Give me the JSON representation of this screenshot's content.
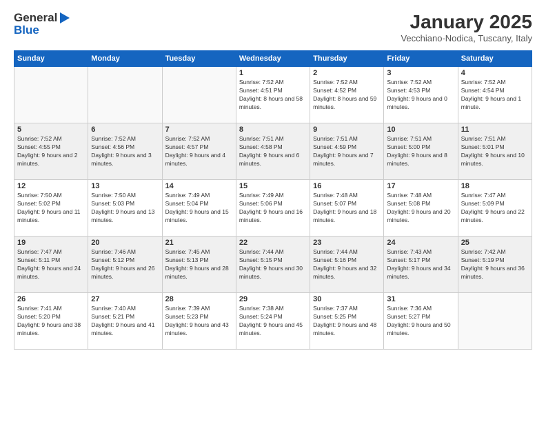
{
  "header": {
    "logo_line1": "General",
    "logo_line2": "Blue",
    "month_title": "January 2025",
    "location": "Vecchiano-Nodica, Tuscany, Italy"
  },
  "weekdays": [
    "Sunday",
    "Monday",
    "Tuesday",
    "Wednesday",
    "Thursday",
    "Friday",
    "Saturday"
  ],
  "weeks": [
    [
      {
        "day": "",
        "info": ""
      },
      {
        "day": "",
        "info": ""
      },
      {
        "day": "",
        "info": ""
      },
      {
        "day": "1",
        "info": "Sunrise: 7:52 AM\nSunset: 4:51 PM\nDaylight: 8 hours and 58 minutes."
      },
      {
        "day": "2",
        "info": "Sunrise: 7:52 AM\nSunset: 4:52 PM\nDaylight: 8 hours and 59 minutes."
      },
      {
        "day": "3",
        "info": "Sunrise: 7:52 AM\nSunset: 4:53 PM\nDaylight: 9 hours and 0 minutes."
      },
      {
        "day": "4",
        "info": "Sunrise: 7:52 AM\nSunset: 4:54 PM\nDaylight: 9 hours and 1 minute."
      }
    ],
    [
      {
        "day": "5",
        "info": "Sunrise: 7:52 AM\nSunset: 4:55 PM\nDaylight: 9 hours and 2 minutes."
      },
      {
        "day": "6",
        "info": "Sunrise: 7:52 AM\nSunset: 4:56 PM\nDaylight: 9 hours and 3 minutes."
      },
      {
        "day": "7",
        "info": "Sunrise: 7:52 AM\nSunset: 4:57 PM\nDaylight: 9 hours and 4 minutes."
      },
      {
        "day": "8",
        "info": "Sunrise: 7:51 AM\nSunset: 4:58 PM\nDaylight: 9 hours and 6 minutes."
      },
      {
        "day": "9",
        "info": "Sunrise: 7:51 AM\nSunset: 4:59 PM\nDaylight: 9 hours and 7 minutes."
      },
      {
        "day": "10",
        "info": "Sunrise: 7:51 AM\nSunset: 5:00 PM\nDaylight: 9 hours and 8 minutes."
      },
      {
        "day": "11",
        "info": "Sunrise: 7:51 AM\nSunset: 5:01 PM\nDaylight: 9 hours and 10 minutes."
      }
    ],
    [
      {
        "day": "12",
        "info": "Sunrise: 7:50 AM\nSunset: 5:02 PM\nDaylight: 9 hours and 11 minutes."
      },
      {
        "day": "13",
        "info": "Sunrise: 7:50 AM\nSunset: 5:03 PM\nDaylight: 9 hours and 13 minutes."
      },
      {
        "day": "14",
        "info": "Sunrise: 7:49 AM\nSunset: 5:04 PM\nDaylight: 9 hours and 15 minutes."
      },
      {
        "day": "15",
        "info": "Sunrise: 7:49 AM\nSunset: 5:06 PM\nDaylight: 9 hours and 16 minutes."
      },
      {
        "day": "16",
        "info": "Sunrise: 7:48 AM\nSunset: 5:07 PM\nDaylight: 9 hours and 18 minutes."
      },
      {
        "day": "17",
        "info": "Sunrise: 7:48 AM\nSunset: 5:08 PM\nDaylight: 9 hours and 20 minutes."
      },
      {
        "day": "18",
        "info": "Sunrise: 7:47 AM\nSunset: 5:09 PM\nDaylight: 9 hours and 22 minutes."
      }
    ],
    [
      {
        "day": "19",
        "info": "Sunrise: 7:47 AM\nSunset: 5:11 PM\nDaylight: 9 hours and 24 minutes."
      },
      {
        "day": "20",
        "info": "Sunrise: 7:46 AM\nSunset: 5:12 PM\nDaylight: 9 hours and 26 minutes."
      },
      {
        "day": "21",
        "info": "Sunrise: 7:45 AM\nSunset: 5:13 PM\nDaylight: 9 hours and 28 minutes."
      },
      {
        "day": "22",
        "info": "Sunrise: 7:44 AM\nSunset: 5:15 PM\nDaylight: 9 hours and 30 minutes."
      },
      {
        "day": "23",
        "info": "Sunrise: 7:44 AM\nSunset: 5:16 PM\nDaylight: 9 hours and 32 minutes."
      },
      {
        "day": "24",
        "info": "Sunrise: 7:43 AM\nSunset: 5:17 PM\nDaylight: 9 hours and 34 minutes."
      },
      {
        "day": "25",
        "info": "Sunrise: 7:42 AM\nSunset: 5:19 PM\nDaylight: 9 hours and 36 minutes."
      }
    ],
    [
      {
        "day": "26",
        "info": "Sunrise: 7:41 AM\nSunset: 5:20 PM\nDaylight: 9 hours and 38 minutes."
      },
      {
        "day": "27",
        "info": "Sunrise: 7:40 AM\nSunset: 5:21 PM\nDaylight: 9 hours and 41 minutes."
      },
      {
        "day": "28",
        "info": "Sunrise: 7:39 AM\nSunset: 5:23 PM\nDaylight: 9 hours and 43 minutes."
      },
      {
        "day": "29",
        "info": "Sunrise: 7:38 AM\nSunset: 5:24 PM\nDaylight: 9 hours and 45 minutes."
      },
      {
        "day": "30",
        "info": "Sunrise: 7:37 AM\nSunset: 5:25 PM\nDaylight: 9 hours and 48 minutes."
      },
      {
        "day": "31",
        "info": "Sunrise: 7:36 AM\nSunset: 5:27 PM\nDaylight: 9 hours and 50 minutes."
      },
      {
        "day": "",
        "info": ""
      }
    ]
  ]
}
